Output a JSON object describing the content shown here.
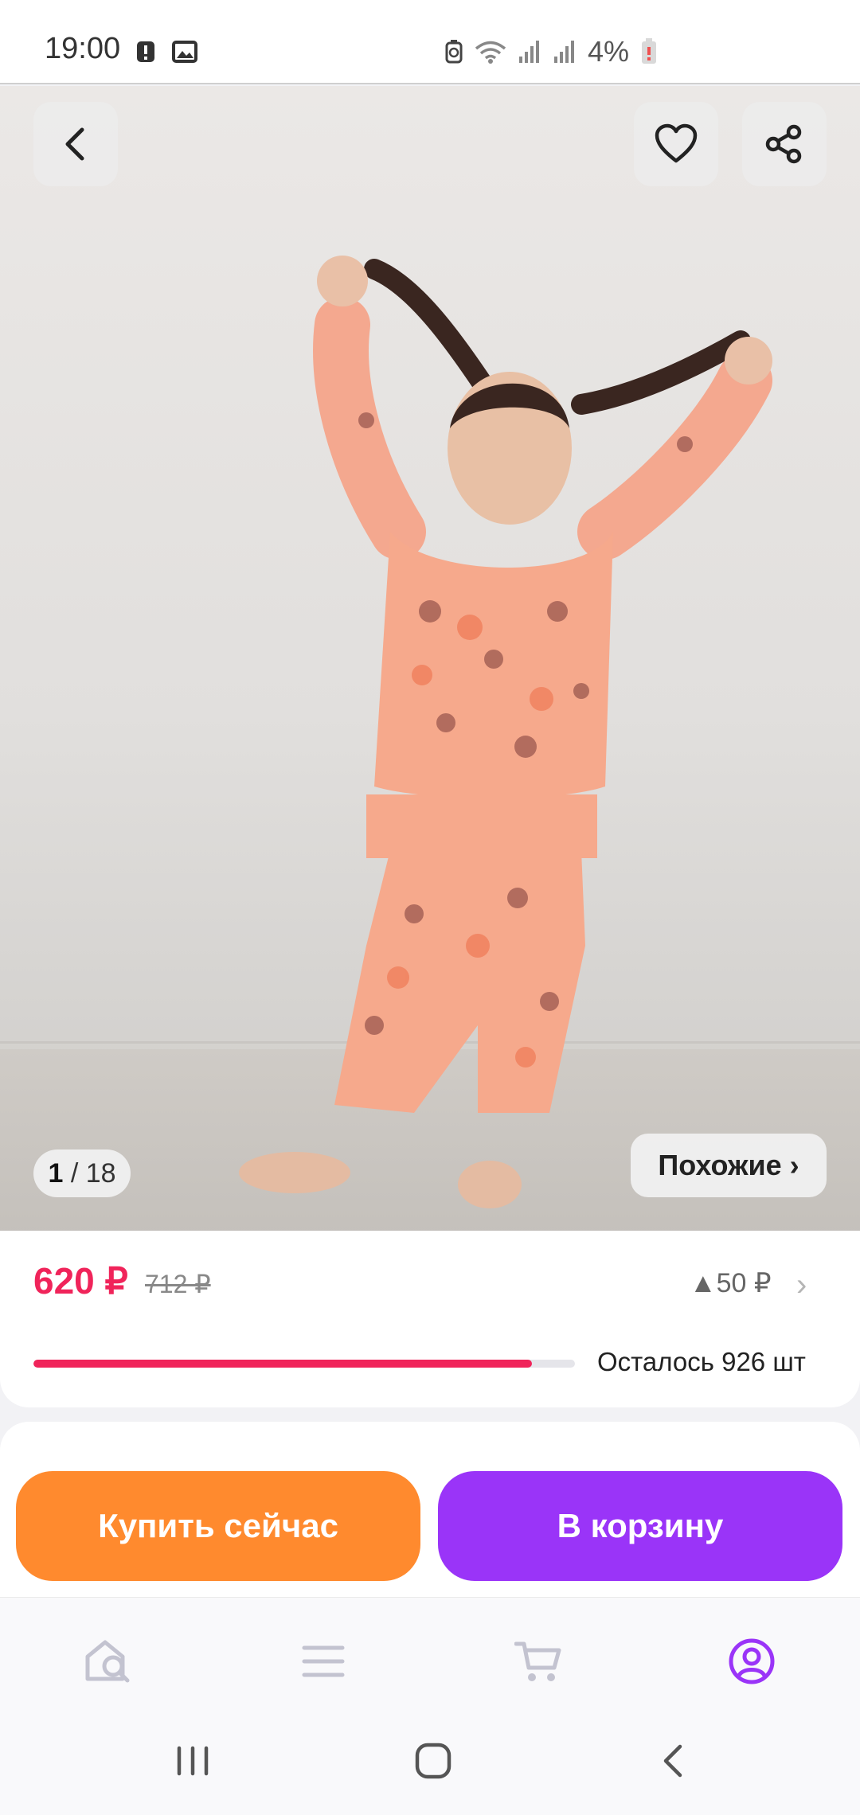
{
  "status_bar": {
    "time": "19:00",
    "battery": "4%",
    "icons": [
      "alert-icon",
      "image-icon",
      "battery-saver-icon",
      "wifi-icon",
      "signal-icon",
      "signal-icon",
      "battery-icon"
    ]
  },
  "gallery": {
    "current": "1",
    "total": "/ 18",
    "similar_label": "Похожие ›"
  },
  "price": {
    "current": "620 ₽",
    "old": "712 ₽",
    "points": "▲50 ₽",
    "stock_text": "Осталось 926 шт",
    "stock_fill": 0.92
  },
  "actions": {
    "buy_now": "Купить сейчас",
    "add_to_cart": "В корзину"
  },
  "tabs": [
    "home-search-icon",
    "catalog-icon",
    "cart-icon",
    "profile-icon"
  ],
  "colors": {
    "price": "#f0245a",
    "buy": "#ff8a2e",
    "cart": "#9a34f8",
    "active_tab": "#9a34f8",
    "inactive_tab": "#c3c3d0"
  }
}
